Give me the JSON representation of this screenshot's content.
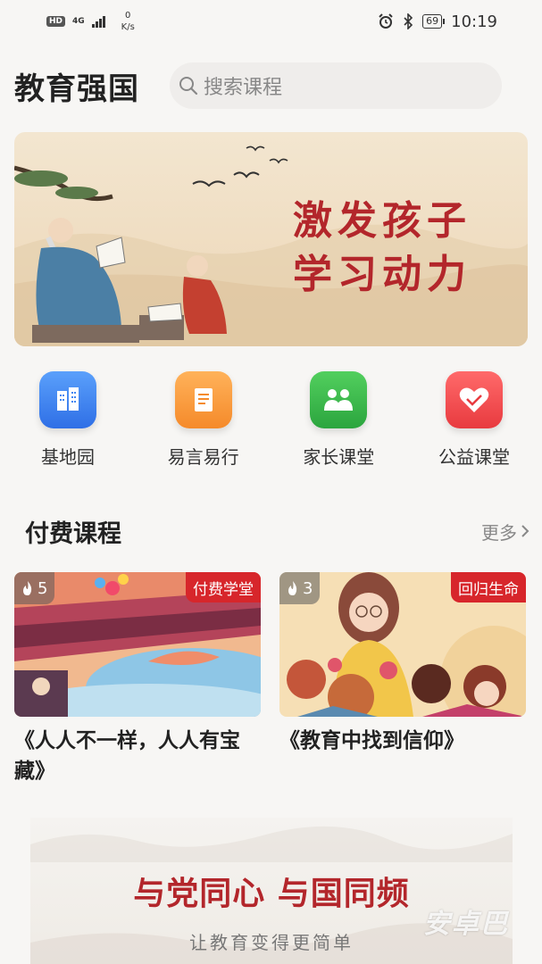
{
  "status_bar": {
    "hd": "HD",
    "network": "4G",
    "speed_value": "0",
    "speed_unit": "K/s",
    "battery": "69",
    "time": "10:19"
  },
  "header": {
    "title": "教育强国",
    "search_placeholder": "搜索课程"
  },
  "banner": {
    "line1": "激发孩子",
    "line2": "学习动力"
  },
  "shortcuts": [
    {
      "label": "基地园",
      "color": "#3f86f3",
      "icon": "building-icon"
    },
    {
      "label": "易言易行",
      "color": "#fb9a3a",
      "icon": "document-icon"
    },
    {
      "label": "家长课堂",
      "color": "#38b84c",
      "icon": "parents-icon"
    },
    {
      "label": "公益课堂",
      "color": "#f2474b",
      "icon": "handshake-icon"
    }
  ],
  "paid_section": {
    "title": "付费课程",
    "more": "更多"
  },
  "courses": [
    {
      "hot": "5",
      "tag": "付费学堂",
      "title": "《人人不一样，人人有宝藏》"
    },
    {
      "hot": "3",
      "tag": "回归生命",
      "title": "《教育中找到信仰》"
    }
  ],
  "slogan": {
    "main": "与党同心 与国同频",
    "sub": "让教育变得更简单"
  },
  "watermark": "安卓巴",
  "colors": {
    "accent_red": "#d7262b",
    "background": "#f7f6f4"
  }
}
